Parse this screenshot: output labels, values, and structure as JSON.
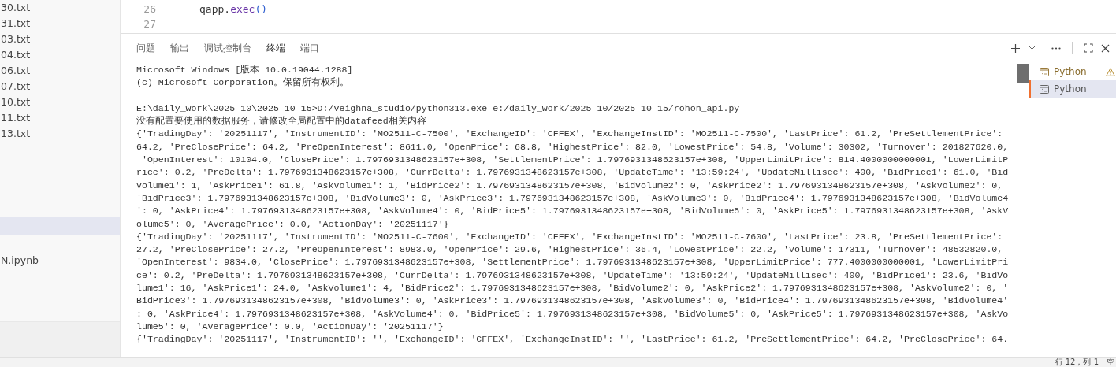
{
  "explorer": {
    "files": [
      "30.txt",
      "31.txt",
      "03.txt",
      "04.txt",
      "06.txt",
      "07.txt",
      "10.txt",
      "11.txt",
      "13.txt"
    ],
    "notebook": "N.ipynb"
  },
  "editor": {
    "lines": [
      {
        "number": "26",
        "tokens": [
          {
            "kind": "plain",
            "text": "qapp."
          },
          {
            "kind": "method",
            "text": "exec"
          },
          {
            "kind": "paren",
            "text": "()"
          }
        ]
      },
      {
        "number": "27"
      }
    ]
  },
  "panel": {
    "tabs": [
      {
        "label": "问题",
        "selected": false
      },
      {
        "label": "输出",
        "selected": false
      },
      {
        "label": "调试控制台",
        "selected": false
      },
      {
        "label": "终端",
        "selected": true
      },
      {
        "label": "端口",
        "selected": false
      }
    ],
    "terminal_blocks": [
      [
        "Microsoft Windows [版本 10.0.19044.1288]",
        "(c) Microsoft Corporation。保留所有权利。"
      ],
      [
        "E:\\daily_work\\2025-10\\2025-10-15>D:/veighna_studio/python313.exe e:/daily_work/2025-10/2025-10-15/rohon_api.py",
        "没有配置要使用的数据服务，请修改全局配置中的datafeed相关内容",
        "{'TradingDay': '20251117', 'InstrumentID': 'MO2511-C-7500', 'ExchangeID': 'CFFEX', 'ExchangeInstID': 'MO2511-C-7500', 'LastPrice': 61.2, 'PreSettlementPrice':",
        "64.2, 'PreClosePrice': 64.2, 'PreOpenInterest': 8611.0, 'OpenPrice': 68.8, 'HighestPrice': 82.0, 'LowestPrice': 54.8, 'Volume': 30302, 'Turnover': 201827620.0,",
        " 'OpenInterest': 10104.0, 'ClosePrice': 1.7976931348623157e+308, 'SettlementPrice': 1.7976931348623157e+308, 'UpperLimitPrice': 814.4000000000001, 'LowerLimitP",
        "rice': 0.2, 'PreDelta': 1.7976931348623157e+308, 'CurrDelta': 1.7976931348623157e+308, 'UpdateTime': '13:59:24', 'UpdateMillisec': 400, 'BidPrice1': 61.0, 'Bid",
        "Volume1': 1, 'AskPrice1': 61.8, 'AskVolume1': 1, 'BidPrice2': 1.7976931348623157e+308, 'BidVolume2': 0, 'AskPrice2': 1.7976931348623157e+308, 'AskVolume2': 0,",
        "'BidPrice3': 1.7976931348623157e+308, 'BidVolume3': 0, 'AskPrice3': 1.7976931348623157e+308, 'AskVolume3': 0, 'BidPrice4': 1.7976931348623157e+308, 'BidVolume4",
        "': 0, 'AskPrice4': 1.7976931348623157e+308, 'AskVolume4': 0, 'BidPrice5': 1.7976931348623157e+308, 'BidVolume5': 0, 'AskPrice5': 1.7976931348623157e+308, 'AskV",
        "olume5': 0, 'AveragePrice': 0.0, 'ActionDay': '20251117'}",
        "{'TradingDay': '20251117', 'InstrumentID': 'MO2511-C-7600', 'ExchangeID': 'CFFEX', 'ExchangeInstID': 'MO2511-C-7600', 'LastPrice': 23.8, 'PreSettlementPrice':",
        "27.2, 'PreClosePrice': 27.2, 'PreOpenInterest': 8983.0, 'OpenPrice': 29.6, 'HighestPrice': 36.4, 'LowestPrice': 22.2, 'Volume': 17311, 'Turnover': 48532820.0,",
        "'OpenInterest': 9834.0, 'ClosePrice': 1.7976931348623157e+308, 'SettlementPrice': 1.7976931348623157e+308, 'UpperLimitPrice': 777.4000000000001, 'LowerLimitPri",
        "ce': 0.2, 'PreDelta': 1.7976931348623157e+308, 'CurrDelta': 1.7976931348623157e+308, 'UpdateTime': '13:59:24', 'UpdateMillisec': 400, 'BidPrice1': 23.6, 'BidVo",
        "lume1': 16, 'AskPrice1': 24.0, 'AskVolume1': 4, 'BidPrice2': 1.7976931348623157e+308, 'BidVolume2': 0, 'AskPrice2': 1.7976931348623157e+308, 'AskVolume2': 0, '",
        "BidPrice3': 1.7976931348623157e+308, 'BidVolume3': 0, 'AskPrice3': 1.7976931348623157e+308, 'AskVolume3': 0, 'BidPrice4': 1.7976931348623157e+308, 'BidVolume4'",
        ": 0, 'AskPrice4': 1.7976931348623157e+308, 'AskVolume4': 0, 'BidPrice5': 1.7976931348623157e+308, 'BidVolume5': 0, 'AskPrice5': 1.7976931348623157e+308, 'AskVo",
        "lume5': 0, 'AveragePrice': 0.0, 'ActionDay': '20251117'}",
        "{'TradingDay': '20251117', 'InstrumentID': '', 'ExchangeID': 'CFFEX', 'ExchangeInstID': '', 'LastPrice': 61.2, 'PreSettlementPrice': 64.2, 'PreClosePrice': 64."
      ]
    ],
    "terminals": [
      {
        "label": "Python",
        "warning": true,
        "selected": false
      },
      {
        "label": "Python",
        "warning": false,
        "selected": true
      }
    ]
  },
  "status_bar": {
    "position": "行 12，列 1",
    "spaces": "空"
  }
}
